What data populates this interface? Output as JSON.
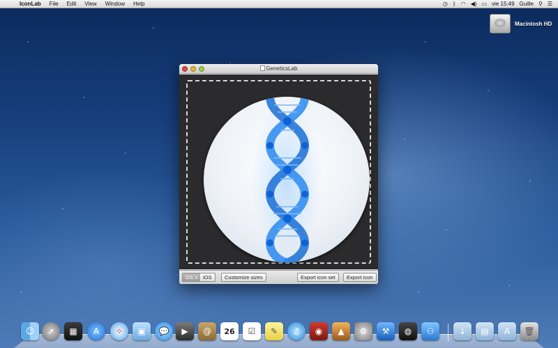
{
  "menubar": {
    "apple_icon": "apple-logo",
    "app_name": "IconLab",
    "menus": [
      "File",
      "Edit",
      "View",
      "Window",
      "Help"
    ],
    "status": {
      "clock": "vie 15:49",
      "user": "Guille"
    }
  },
  "desktop": {
    "drive_label": "Macintosh HD"
  },
  "window": {
    "title": "GeneticsLab",
    "buttons": {
      "osx": "OS X",
      "ios": "iOS",
      "customize": "Customize sizes",
      "export_set": "Export icon set",
      "export": "Export icon"
    }
  },
  "dock": {
    "items": [
      "finder",
      "launchpad",
      "mission-control",
      "app-store",
      "safari",
      "preview",
      "messages",
      "facetime",
      "contacts",
      "calendar",
      "reminders",
      "notes",
      "itunes",
      "photo-booth",
      "iphoto",
      "system-preferences",
      "xcode",
      "iconlab",
      "blue-app",
      "downloads-folder",
      "documents-folder",
      "applications-folder",
      "trash"
    ],
    "calendar_day": "26"
  },
  "colors": {
    "accent_blue": "#1a6fd6",
    "close": "#e0463f",
    "minimize": "#e4b43b",
    "zoom": "#9fce4a"
  }
}
